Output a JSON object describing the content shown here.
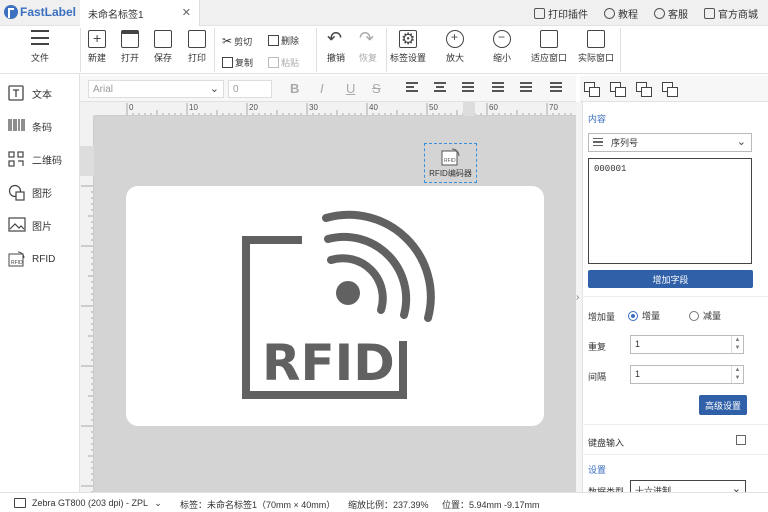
{
  "app": {
    "name": "FastLabel"
  },
  "document_tab": {
    "title": "未命名标签1",
    "close": "✕"
  },
  "top_links": [
    "打印插件",
    "教程",
    "客服",
    "官方商城"
  ],
  "toolbar": {
    "file": "文件",
    "new": "新建",
    "open": "打开",
    "save": "保存",
    "print": "打印",
    "cut": "剪切",
    "delete": "删除",
    "copy": "复制",
    "paste": "粘贴",
    "undo": "撤销",
    "redo": "恢复",
    "label_settings": "标签设置",
    "zoom_in": "放大",
    "zoom_out": "缩小",
    "fit_window": "适应窗口",
    "actual_window": "实际窗口"
  },
  "sidebar": {
    "items": [
      {
        "label": "文本",
        "icon": "text-icon"
      },
      {
        "label": "条码",
        "icon": "barcode-icon"
      },
      {
        "label": "二维码",
        "icon": "qrcode-icon"
      },
      {
        "label": "图形",
        "icon": "shape-icon"
      },
      {
        "label": "图片",
        "icon": "image-icon"
      },
      {
        "label": "RFID",
        "icon": "rfid-icon"
      }
    ]
  },
  "format_bar": {
    "font_placeholder": "Arial",
    "size_value": "0",
    "bold": "B",
    "italic": "I",
    "underline": "U",
    "strike": "S"
  },
  "ruler": {
    "h_ticks": [
      "0",
      "10",
      "20",
      "30",
      "40",
      "50",
      "60",
      "70"
    ]
  },
  "canvas": {
    "encoder_label": "RFID编码器",
    "badge_text": "RFID",
    "art_text": "RFID"
  },
  "panel": {
    "content_title": "内容",
    "content_type": "序列号",
    "content_value": "000001",
    "add_field": "增加字段",
    "increment_label": "增加量",
    "increment_options": [
      "增量",
      "减量"
    ],
    "increment_selected": "增量",
    "repeat_label": "重复",
    "repeat_value": "1",
    "interval_label": "间隔",
    "interval_value": "1",
    "advanced": "高级设置",
    "keyboard_input": "键盘输入",
    "settings_title": "设置",
    "data_type_label": "数据类型",
    "data_type_value": "十六进制"
  },
  "status": {
    "printer": "Zebra GT800 (203 dpi) - ZPL",
    "label": "标签：未命名标签1（70mm × 40mm）",
    "zoom": "缩放比例：237.39%",
    "position": "位置：5.94mm -9.17mm"
  },
  "colors": {
    "accent": "#3b6fc0",
    "primary_button": "#3060a8",
    "canvas_bg": "#d4d4d4",
    "art": "#616161"
  }
}
